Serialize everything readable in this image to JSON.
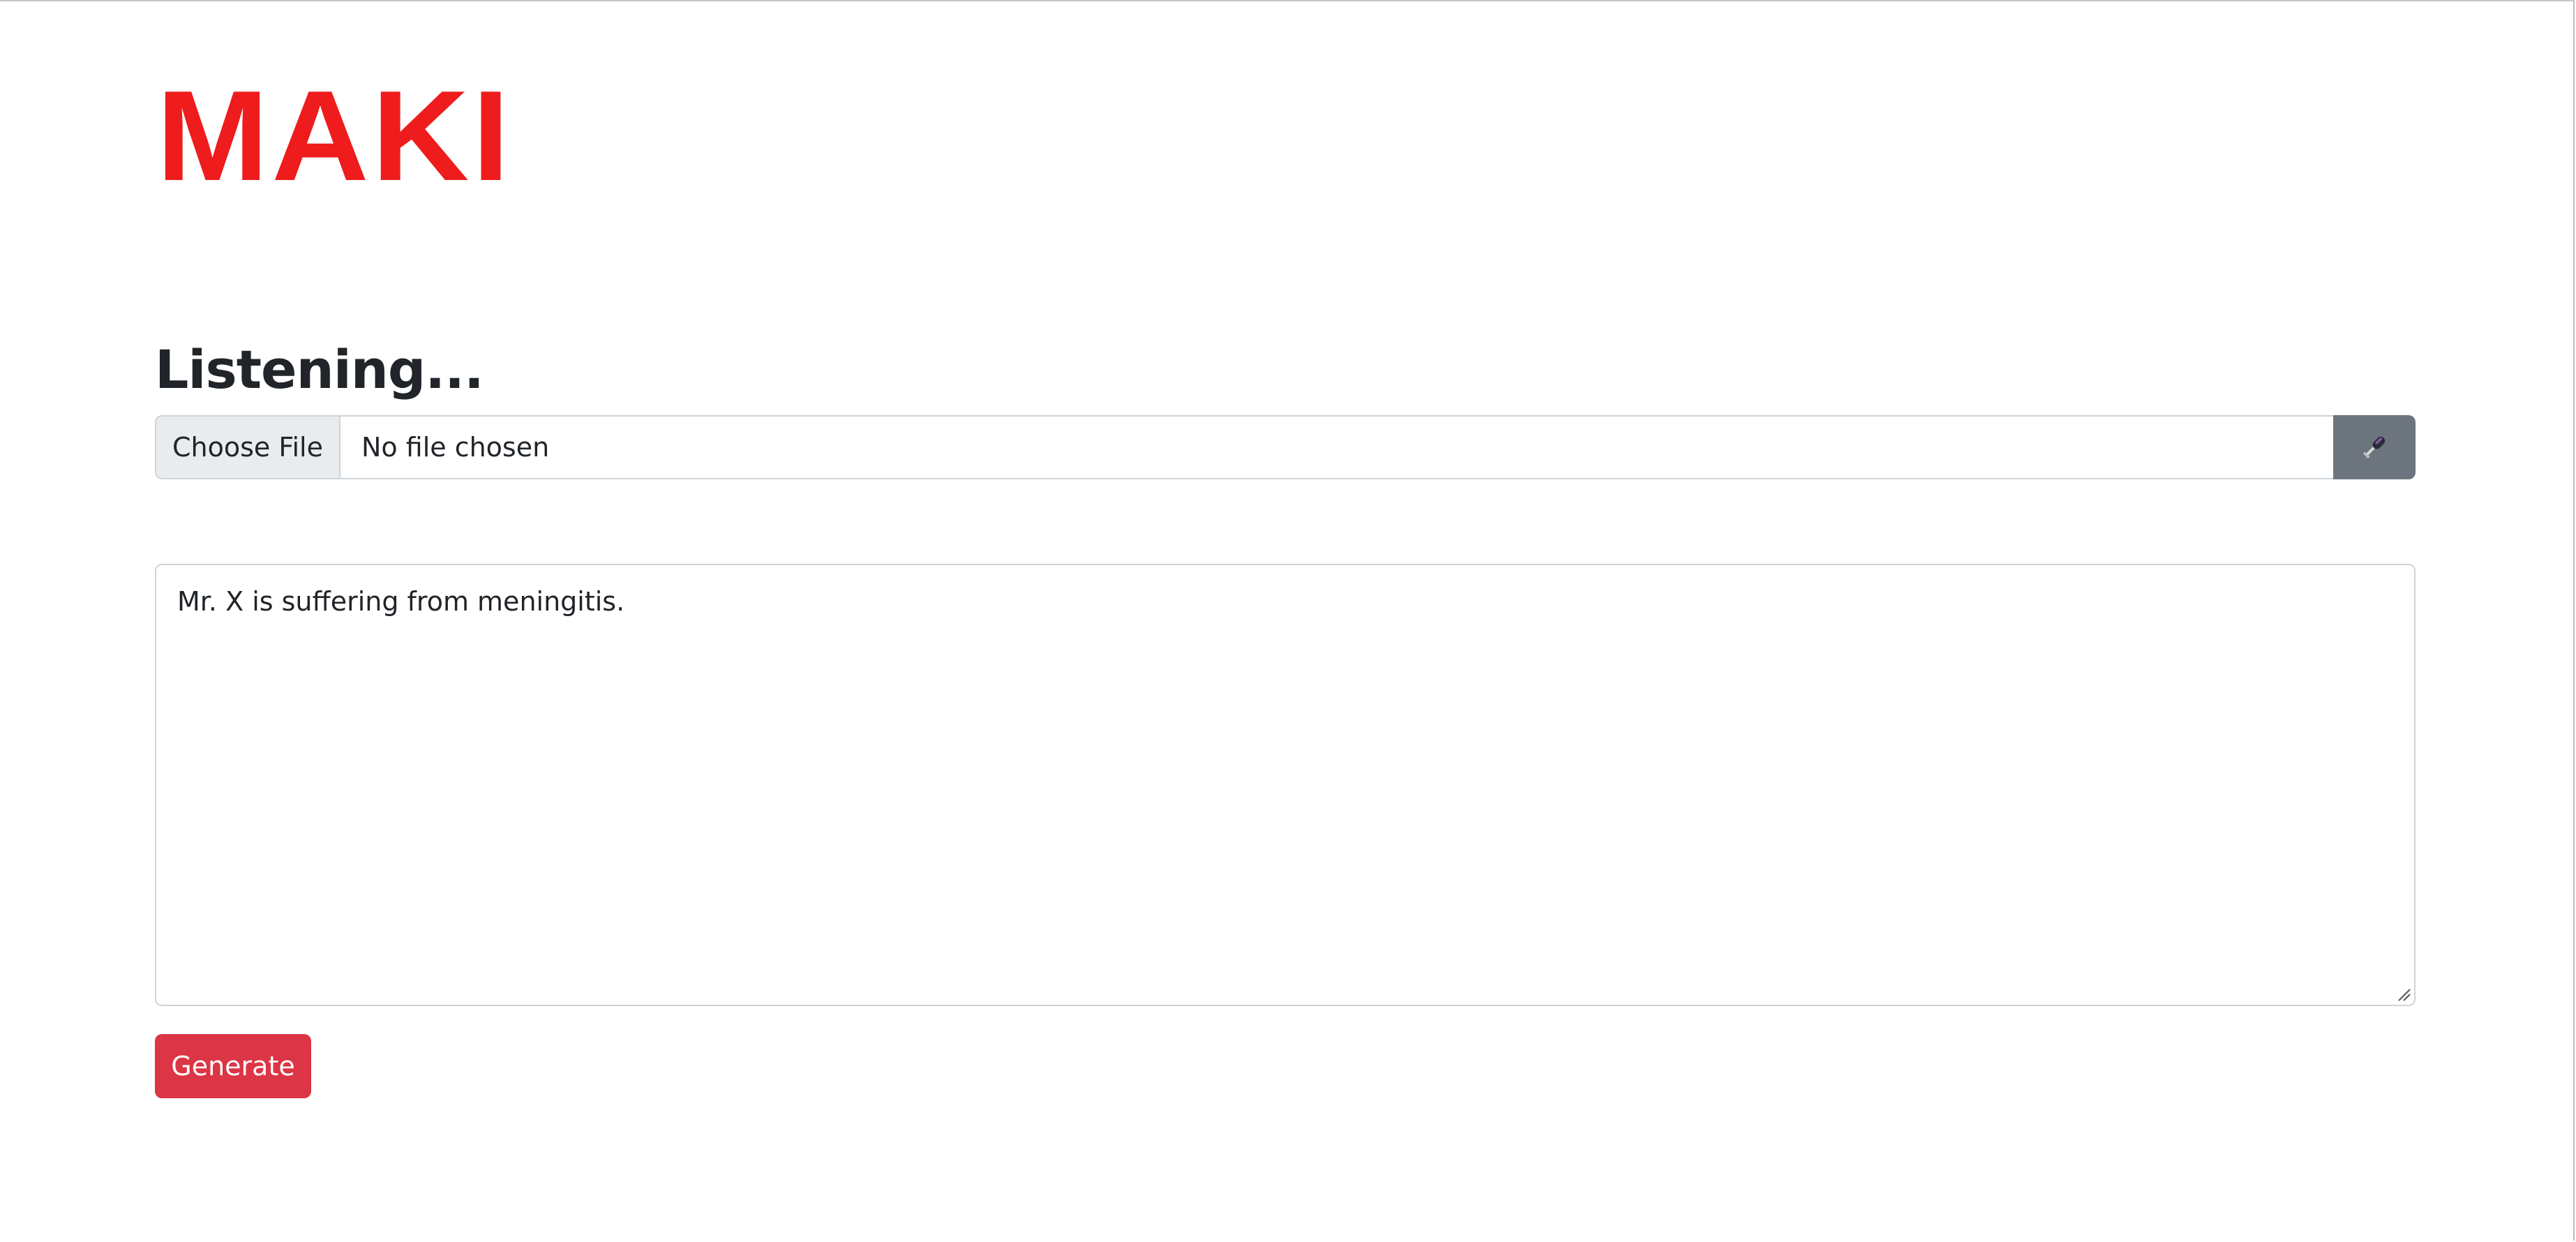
{
  "app": {
    "logo_text": "MAKI",
    "brand_color": "#ee1c1c"
  },
  "status": {
    "heading": "Listening..."
  },
  "file_input": {
    "button_label": "Choose File",
    "file_name": "No file chosen"
  },
  "mic_button": {
    "icon": "microphone-icon",
    "background_color": "#6c757d"
  },
  "transcript": {
    "value": "Mr. X is suffering from meningitis."
  },
  "actions": {
    "generate_label": "Generate",
    "generate_color": "#dc3545"
  }
}
